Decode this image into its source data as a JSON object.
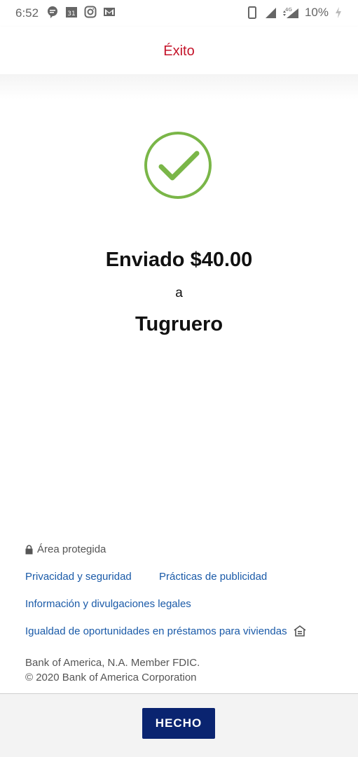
{
  "status_bar": {
    "time": "6:52",
    "calendar_day": "31",
    "network": "4G",
    "battery": "10%",
    "icons_left": [
      "chat-bubble-icon",
      "calendar-icon",
      "instagram-icon",
      "gmail-icon"
    ],
    "icons_right": [
      "vibrate-icon",
      "signal-icon",
      "signal-4g-icon",
      "battery-charging-icon"
    ]
  },
  "header": {
    "title": "Éxito"
  },
  "confirmation": {
    "sent_amount": "Enviado $40.00",
    "to_word": "a",
    "recipient": "Tugruero",
    "check_color": "#7ab648"
  },
  "footer": {
    "secure_area": "Área protegida",
    "links": {
      "privacy": "Privacidad y seguridad",
      "advertising": "Prácticas de publicidad",
      "legal": "Información y divulgaciones legales",
      "equal_housing": "Igualdad de oportunidades en préstamos para viviendas"
    },
    "legal_line1": "Bank of America, N.A. Member FDIC.",
    "legal_line2": "© 2020 Bank of America Corporation"
  },
  "actions": {
    "done_label": "HECHO"
  },
  "colors": {
    "header_title": "#c4142a",
    "link": "#1a5aa8",
    "button": "#0a2470",
    "check": "#7ab648"
  }
}
